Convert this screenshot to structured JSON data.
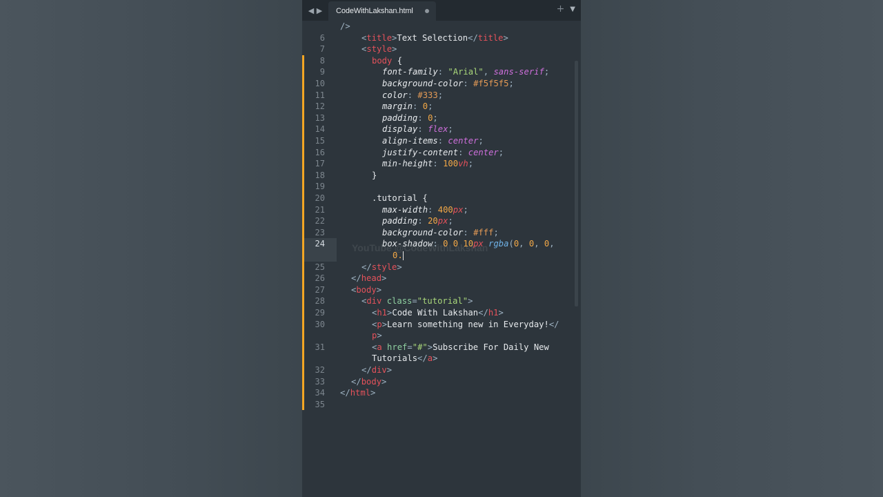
{
  "tab": {
    "filename": "CodeWithLakshan.html"
  },
  "watermark": "YouTube @CodeWithLakshan",
  "lines": [
    {
      "n": "",
      "tokens": [
        [
          "punct",
          "/>"
        ]
      ]
    },
    {
      "n": "6",
      "tokens": [
        [
          "punct",
          "<"
        ],
        [
          "tag",
          "title"
        ],
        [
          "punct",
          ">"
        ],
        [
          "plain",
          "Text Selection"
        ],
        [
          "punct",
          "</"
        ],
        [
          "tag",
          "title"
        ],
        [
          "punct",
          ">"
        ]
      ]
    },
    {
      "n": "7",
      "tokens": [
        [
          "punct",
          "<"
        ],
        [
          "tag",
          "style"
        ],
        [
          "punct",
          ">"
        ]
      ]
    },
    {
      "n": "8",
      "tokens": [
        [
          "tag",
          "body"
        ],
        [
          "plain",
          " {"
        ]
      ]
    },
    {
      "n": "9",
      "tokens": [
        [
          "prop",
          "font-family"
        ],
        [
          "punct",
          ": "
        ],
        [
          "str",
          "\"Arial\""
        ],
        [
          "punct",
          ", "
        ],
        [
          "kw",
          "sans-serif"
        ],
        [
          "punct",
          ";"
        ]
      ]
    },
    {
      "n": "10",
      "tokens": [
        [
          "prop",
          "background-color"
        ],
        [
          "punct",
          ": "
        ],
        [
          "hex",
          "#f5f5f5"
        ],
        [
          "punct",
          ";"
        ]
      ]
    },
    {
      "n": "11",
      "tokens": [
        [
          "prop",
          "color"
        ],
        [
          "punct",
          ": "
        ],
        [
          "hex",
          "#333"
        ],
        [
          "punct",
          ";"
        ]
      ]
    },
    {
      "n": "12",
      "tokens": [
        [
          "prop",
          "margin"
        ],
        [
          "punct",
          ": "
        ],
        [
          "num",
          "0"
        ],
        [
          "punct",
          ";"
        ]
      ]
    },
    {
      "n": "13",
      "tokens": [
        [
          "prop",
          "padding"
        ],
        [
          "punct",
          ": "
        ],
        [
          "num",
          "0"
        ],
        [
          "punct",
          ";"
        ]
      ]
    },
    {
      "n": "14",
      "tokens": [
        [
          "prop",
          "display"
        ],
        [
          "punct",
          ": "
        ],
        [
          "kw",
          "flex"
        ],
        [
          "punct",
          ";"
        ]
      ]
    },
    {
      "n": "15",
      "tokens": [
        [
          "prop",
          "align-items"
        ],
        [
          "punct",
          ": "
        ],
        [
          "kw",
          "center"
        ],
        [
          "punct",
          ";"
        ]
      ]
    },
    {
      "n": "16",
      "tokens": [
        [
          "prop",
          "justify-content"
        ],
        [
          "punct",
          ": "
        ],
        [
          "kw",
          "center"
        ],
        [
          "punct",
          ";"
        ]
      ]
    },
    {
      "n": "17",
      "tokens": [
        [
          "prop",
          "min-height"
        ],
        [
          "punct",
          ": "
        ],
        [
          "num",
          "100"
        ],
        [
          "unit",
          "vh"
        ],
        [
          "punct",
          ";"
        ]
      ]
    },
    {
      "n": "18",
      "tokens": [
        [
          "plain",
          "}"
        ]
      ]
    },
    {
      "n": "19",
      "tokens": []
    },
    {
      "n": "20",
      "tokens": [
        [
          "sel",
          ".tutorial"
        ],
        [
          "plain",
          " {"
        ]
      ]
    },
    {
      "n": "21",
      "tokens": [
        [
          "prop",
          "max-width"
        ],
        [
          "punct",
          ": "
        ],
        [
          "num",
          "400"
        ],
        [
          "unit",
          "px"
        ],
        [
          "punct",
          ";"
        ]
      ]
    },
    {
      "n": "22",
      "tokens": [
        [
          "prop",
          "padding"
        ],
        [
          "punct",
          ": "
        ],
        [
          "num",
          "20"
        ],
        [
          "unit",
          "px"
        ],
        [
          "punct",
          ";"
        ]
      ]
    },
    {
      "n": "23",
      "tokens": [
        [
          "prop",
          "background-color"
        ],
        [
          "punct",
          ": "
        ],
        [
          "hex",
          "#fff"
        ],
        [
          "punct",
          ";"
        ]
      ]
    },
    {
      "n": "24",
      "tokens": [
        [
          "prop",
          "box-shadow"
        ],
        [
          "punct",
          ": "
        ],
        [
          "num",
          "0 0 10"
        ],
        [
          "unit",
          "px"
        ],
        [
          "plain",
          " "
        ],
        [
          "fn",
          "rgba"
        ],
        [
          "punct",
          "("
        ],
        [
          "num",
          "0"
        ],
        [
          "punct",
          ", "
        ],
        [
          "num",
          "0"
        ],
        [
          "punct",
          ", "
        ],
        [
          "num",
          "0"
        ],
        [
          "punct",
          ","
        ]
      ]
    },
    {
      "n": "",
      "tokens": [
        [
          "num",
          "0."
        ]
      ]
    },
    {
      "n": "25",
      "tokens": [
        [
          "punct",
          "</"
        ],
        [
          "tag",
          "style"
        ],
        [
          "punct",
          ">"
        ]
      ]
    },
    {
      "n": "26",
      "tokens": [
        [
          "punct",
          "</"
        ],
        [
          "tag",
          "head"
        ],
        [
          "punct",
          ">"
        ]
      ]
    },
    {
      "n": "27",
      "tokens": [
        [
          "punct",
          "<"
        ],
        [
          "tag",
          "body"
        ],
        [
          "punct",
          ">"
        ]
      ]
    },
    {
      "n": "28",
      "tokens": [
        [
          "punct",
          "<"
        ],
        [
          "tag",
          "div"
        ],
        [
          "plain",
          " "
        ],
        [
          "attr",
          "class"
        ],
        [
          "punct",
          "="
        ],
        [
          "str",
          "\"tutorial\""
        ],
        [
          "punct",
          ">"
        ]
      ]
    },
    {
      "n": "29",
      "tokens": [
        [
          "punct",
          "<"
        ],
        [
          "tag",
          "h1"
        ],
        [
          "punct",
          ">"
        ],
        [
          "plain",
          "Code With Lakshan"
        ],
        [
          "punct",
          "</"
        ],
        [
          "tag",
          "h1"
        ],
        [
          "punct",
          ">"
        ]
      ]
    },
    {
      "n": "30",
      "tokens": [
        [
          "punct",
          "<"
        ],
        [
          "tag",
          "p"
        ],
        [
          "punct",
          ">"
        ],
        [
          "plain",
          "Learn something new in Everyday!"
        ],
        [
          "punct",
          "</"
        ]
      ]
    },
    {
      "n": "",
      "tokens": [
        [
          "tag",
          "p"
        ],
        [
          "punct",
          ">"
        ]
      ]
    },
    {
      "n": "31",
      "tokens": [
        [
          "punct",
          "<"
        ],
        [
          "tag",
          "a"
        ],
        [
          "plain",
          " "
        ],
        [
          "attr",
          "href"
        ],
        [
          "punct",
          "="
        ],
        [
          "str",
          "\"#\""
        ],
        [
          "punct",
          ">"
        ],
        [
          "plain",
          "Subscribe For Daily New"
        ]
      ]
    },
    {
      "n": "",
      "tokens": [
        [
          "plain",
          "Tutorials"
        ],
        [
          "punct",
          "</"
        ],
        [
          "tag",
          "a"
        ],
        [
          "punct",
          ">"
        ]
      ]
    },
    {
      "n": "32",
      "tokens": [
        [
          "punct",
          "</"
        ],
        [
          "tag",
          "div"
        ],
        [
          "punct",
          ">"
        ]
      ]
    },
    {
      "n": "33",
      "tokens": [
        [
          "punct",
          "</"
        ],
        [
          "tag",
          "body"
        ],
        [
          "punct",
          ">"
        ]
      ]
    },
    {
      "n": "34",
      "tokens": [
        [
          "punct",
          "</"
        ],
        [
          "tag",
          "html"
        ],
        [
          "punct",
          ">"
        ]
      ]
    },
    {
      "n": "35",
      "tokens": []
    }
  ]
}
